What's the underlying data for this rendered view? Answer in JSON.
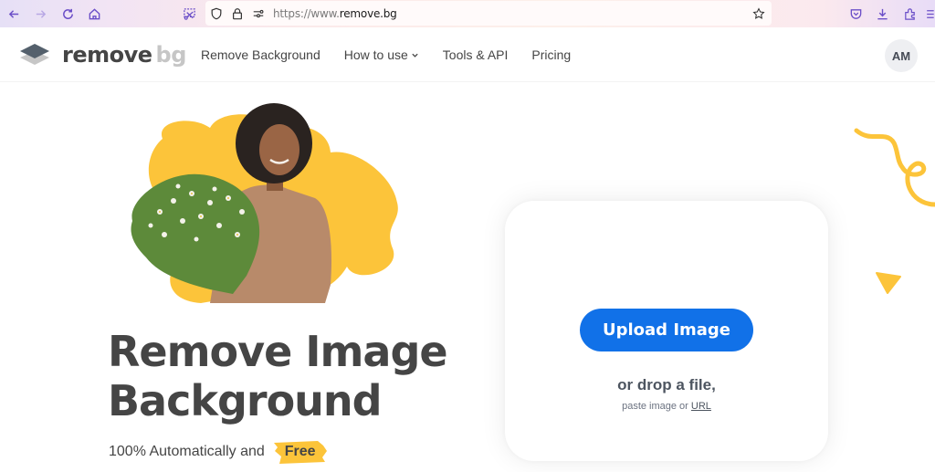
{
  "browser": {
    "url_prefix": "https://www.",
    "url_domain": "remove.bg",
    "icons": [
      "back-icon",
      "forward-icon",
      "reload-icon",
      "home-icon",
      "screenshot-icon",
      "shield-icon",
      "lock-icon",
      "permissions-icon",
      "bookmark-star-icon",
      "pocket-icon",
      "download-icon",
      "extensions-icon",
      "menu-icon"
    ]
  },
  "header": {
    "logo_primary": "remove",
    "logo_secondary": "bg",
    "nav": [
      {
        "label": "Remove Background"
      },
      {
        "label": "How to use",
        "has_dropdown": true
      },
      {
        "label": "Tools & API"
      },
      {
        "label": "Pricing"
      }
    ],
    "avatar_initials": "AM"
  },
  "hero": {
    "title_line1": "Remove Image",
    "title_line2": "Background",
    "subtitle": "100% Automatically and",
    "badge": "Free"
  },
  "upload": {
    "button_label": "Upload Image",
    "drop_text": "or drop a file,",
    "paste_text": "paste image or",
    "url_link": "URL"
  },
  "colors": {
    "accent_blue": "#1171e8",
    "brand_yellow": "#fcc43a",
    "text_dark": "#454545",
    "browser_icon_purple": "#6b4fc8"
  }
}
